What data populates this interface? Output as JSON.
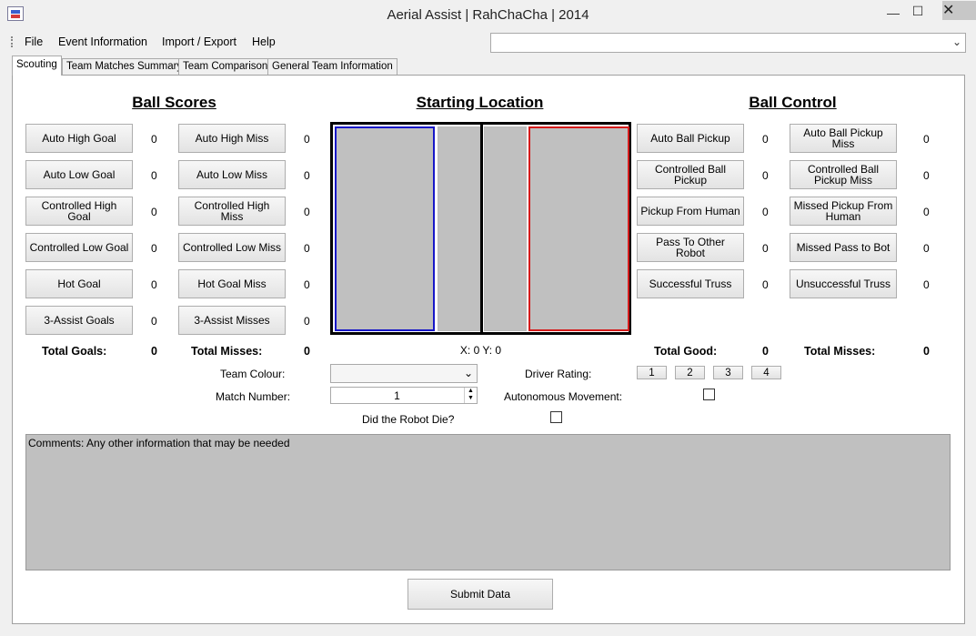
{
  "window": {
    "title": "Aerial Assist | RahChaCha | 2014",
    "minimize": "—",
    "maximize": "☐",
    "close": "✕"
  },
  "menu": [
    "File",
    "Event Information",
    "Import / Export",
    "Help"
  ],
  "top_combo": {
    "value": ""
  },
  "tabs": [
    {
      "label": "Scouting",
      "active": true
    },
    {
      "label": "Team Matches Summary",
      "active": false
    },
    {
      "label": "Team Comparison",
      "active": false
    },
    {
      "label": "General Team Information",
      "active": false
    }
  ],
  "ball_scores": {
    "title": "Ball Scores",
    "goals": [
      {
        "label": "Auto High Goal",
        "count": "0"
      },
      {
        "label": "Auto Low Goal",
        "count": "0"
      },
      {
        "label": "Controlled High Goal",
        "count": "0"
      },
      {
        "label": "Controlled Low Goal",
        "count": "0"
      },
      {
        "label": "Hot Goal",
        "count": "0"
      },
      {
        "label": "3-Assist Goals",
        "count": "0"
      }
    ],
    "misses": [
      {
        "label": "Auto High Miss",
        "count": "0"
      },
      {
        "label": "Auto Low Miss",
        "count": "0"
      },
      {
        "label": "Controlled High Miss",
        "count": "0"
      },
      {
        "label": "Controlled Low Miss",
        "count": "0"
      },
      {
        "label": "Hot Goal Miss",
        "count": "0"
      },
      {
        "label": "3-Assist Misses",
        "count": "0"
      }
    ],
    "total_goals_label": "Total Goals:",
    "total_goals": "0",
    "total_misses_label": "Total Misses:",
    "total_misses": "0"
  },
  "starting_location": {
    "title": "Starting Location",
    "coords": "X: 0 Y: 0",
    "colors": {
      "blue": "#1717c8",
      "red": "#d51b1b",
      "zone": "#c0c0c0"
    }
  },
  "ball_control": {
    "title": "Ball Control",
    "good": [
      {
        "label": "Auto Ball Pickup",
        "count": "0"
      },
      {
        "label": "Controlled Ball Pickup",
        "count": "0"
      },
      {
        "label": "Pickup From Human",
        "count": "0"
      },
      {
        "label": "Pass To Other Robot",
        "count": "0"
      },
      {
        "label": "Successful Truss",
        "count": "0"
      }
    ],
    "bad": [
      {
        "label": "Auto Ball Pickup Miss",
        "count": "0"
      },
      {
        "label": "Controlled Ball Pickup Miss",
        "count": "0"
      },
      {
        "label": "Missed Pickup From Human",
        "count": "0"
      },
      {
        "label": "Missed Pass to Bot",
        "count": "0"
      },
      {
        "label": "Unsuccessful Truss",
        "count": "0"
      }
    ],
    "total_good_label": "Total Good:",
    "total_good": "0",
    "total_misses_label": "Total Misses:",
    "total_misses": "0"
  },
  "form": {
    "team_colour_label": "Team Colour:",
    "team_colour_value": "",
    "match_number_label": "Match Number:",
    "match_number_value": "1",
    "robot_die_label": "Did the Robot Die?",
    "driver_rating_label": "Driver Rating:",
    "driver_ratings": [
      "1",
      "2",
      "3",
      "4"
    ],
    "autonomous_label": "Autonomous Movement:"
  },
  "comments": {
    "text": "Comments: Any other information that may be needed"
  },
  "submit_label": "Submit Data"
}
